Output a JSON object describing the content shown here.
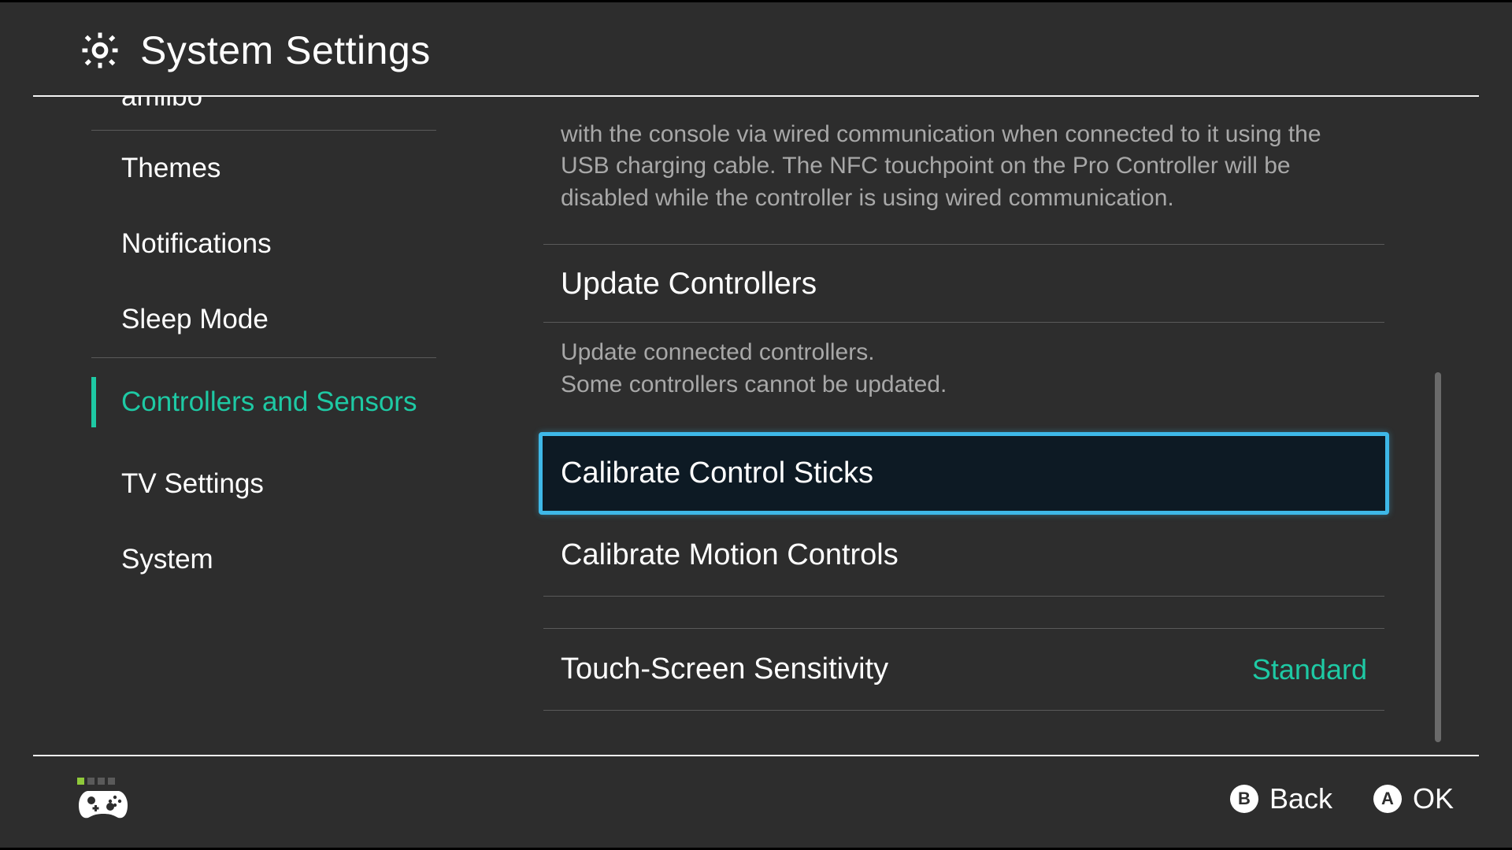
{
  "header": {
    "title": "System Settings"
  },
  "sidebar": {
    "items": [
      {
        "label": "amiibo"
      },
      {
        "label": "Themes"
      },
      {
        "label": "Notifications"
      },
      {
        "label": "Sleep Mode"
      },
      {
        "label": "Controllers and Sensors"
      },
      {
        "label": "TV Settings"
      },
      {
        "label": "System"
      }
    ]
  },
  "content": {
    "wired_desc": "with the console via wired communication when connected to it using the USB charging cable. The NFC touchpoint on the Pro Controller will be disabled while the controller is using wired communication.",
    "update_title": "Update Controllers",
    "update_desc_line1": "Update connected controllers.",
    "update_desc_line2": "Some controllers cannot be updated.",
    "calibrate_sticks": "Calibrate Control Sticks",
    "calibrate_motion": "Calibrate Motion Controls",
    "touch_sensitivity": "Touch-Screen Sensitivity",
    "touch_value": "Standard"
  },
  "footer": {
    "back_button": "B",
    "back_label": "Back",
    "ok_button": "A",
    "ok_label": "OK"
  }
}
